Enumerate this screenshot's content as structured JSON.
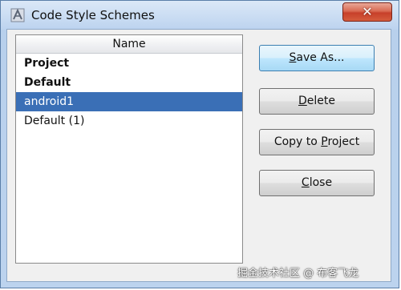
{
  "window": {
    "title": "Code Style Schemes",
    "close_glyph": "✕"
  },
  "list": {
    "column_header": "Name",
    "items": [
      {
        "label": "Project",
        "bold": true,
        "selected": false
      },
      {
        "label": "Default",
        "bold": true,
        "selected": false
      },
      {
        "label": "android1",
        "bold": false,
        "selected": true
      },
      {
        "label": "Default (1)",
        "bold": false,
        "selected": false
      }
    ]
  },
  "buttons": {
    "save_as": {
      "prefix": "",
      "mnemonic": "S",
      "suffix": "ave As..."
    },
    "delete": {
      "prefix": "",
      "mnemonic": "D",
      "suffix": "elete"
    },
    "copy_to_project": {
      "prefix": "Copy to ",
      "mnemonic": "P",
      "suffix": "roject"
    },
    "close": {
      "prefix": "",
      "mnemonic": "C",
      "suffix": "lose"
    }
  },
  "watermark": "掘金技术社区 @ 布客飞龙",
  "colors": {
    "selection": "#3a6fb6",
    "title_bar": "#bcd3ef",
    "close_button": "#c7402a",
    "default_button_border": "#3c7fb1"
  },
  "icons": {
    "title_icon": "intellij-app-icon",
    "close_icon": "close-icon"
  }
}
